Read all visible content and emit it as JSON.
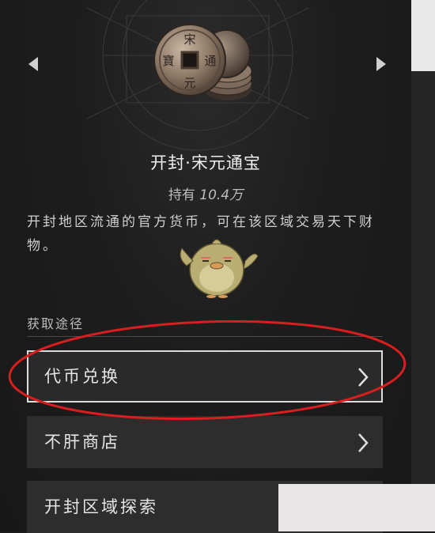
{
  "item": {
    "title": "开封·宋元通宝",
    "holding_prefix": "持有",
    "holding_amount": "10.4万",
    "description": "开封地区流通的官方货币，可在该区域交易天下财物。",
    "coin_characters": [
      "宋",
      "通",
      "元",
      "寶"
    ]
  },
  "nav": {
    "prev_icon": "triangle-left-icon",
    "next_icon": "triangle-right-icon"
  },
  "acquire": {
    "section_label": "获取途径",
    "options": [
      {
        "label": "代币兑换",
        "highlighted": true
      },
      {
        "label": "不肝商店",
        "highlighted": false
      },
      {
        "label": "开封区域探索",
        "highlighted": false
      }
    ]
  },
  "colors": {
    "background": "#1c1c1c",
    "row_bg": "#2d2d2d",
    "highlight_border": "#dcdcdc",
    "annotation_red": "#d81e1e"
  }
}
